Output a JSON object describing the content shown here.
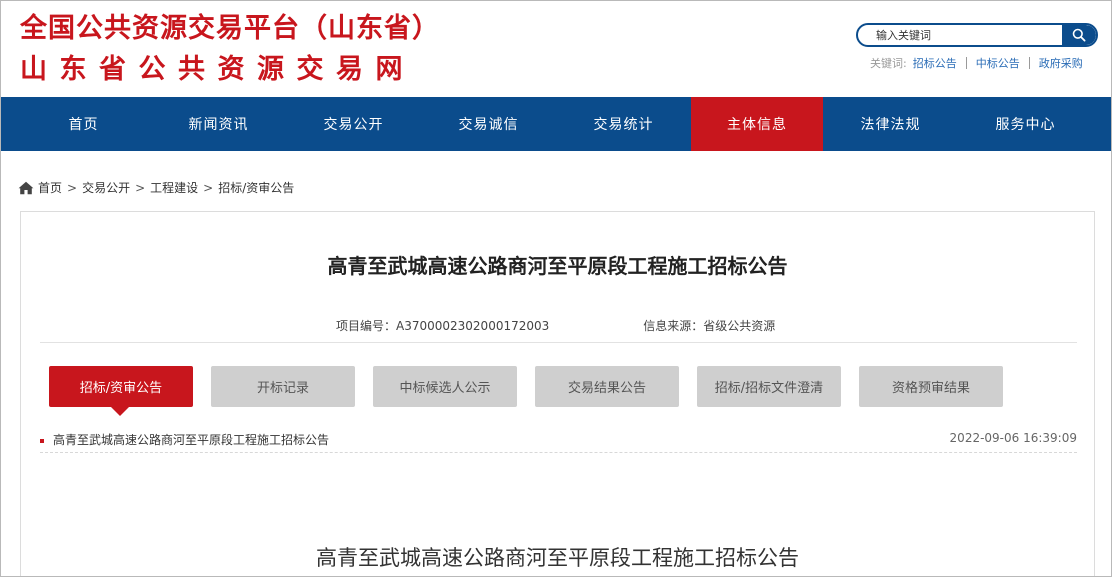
{
  "header": {
    "logo_line1": "全国公共资源交易平台（山东省）",
    "logo_line2": "山东省公共资源交易网",
    "search": {
      "placeholder": "输入关键词"
    },
    "keywords": {
      "label": "关键词:",
      "links": [
        "招标公告",
        "中标公告",
        "政府采购"
      ]
    }
  },
  "nav": {
    "items": [
      "首页",
      "新闻资讯",
      "交易公开",
      "交易诚信",
      "交易统计",
      "主体信息",
      "法律法规",
      "服务中心"
    ],
    "active_index": 5
  },
  "breadcrumb": [
    "首页",
    "交易公开",
    "工程建设",
    "招标/资审公告"
  ],
  "breadcrumb_separator": ">",
  "content": {
    "title": "高青至武城高速公路商河至平原段工程施工招标公告",
    "project_no": "项目编号：A3700002302000172003",
    "source": "信息来源：省级公共资源",
    "tabs": [
      "招标/资审公告",
      "开标记录",
      "中标候选人公示",
      "交易结果公告",
      "招标/招标文件澄清",
      "资格预审结果"
    ],
    "active_tab": 0,
    "list": [
      {
        "title": "高青至武城高速公路商河至平原段工程施工招标公告",
        "date": "2022-09-06 16:39:09"
      }
    ],
    "bottom_title": "高青至武城高速公路商河至平原段工程施工招标公告"
  },
  "colors": {
    "brand_red": "#c8161d",
    "nav_blue": "#0b4c8c",
    "link_blue": "#2a6cb6"
  },
  "icons": {
    "search": "search-icon",
    "home": "home-icon"
  }
}
